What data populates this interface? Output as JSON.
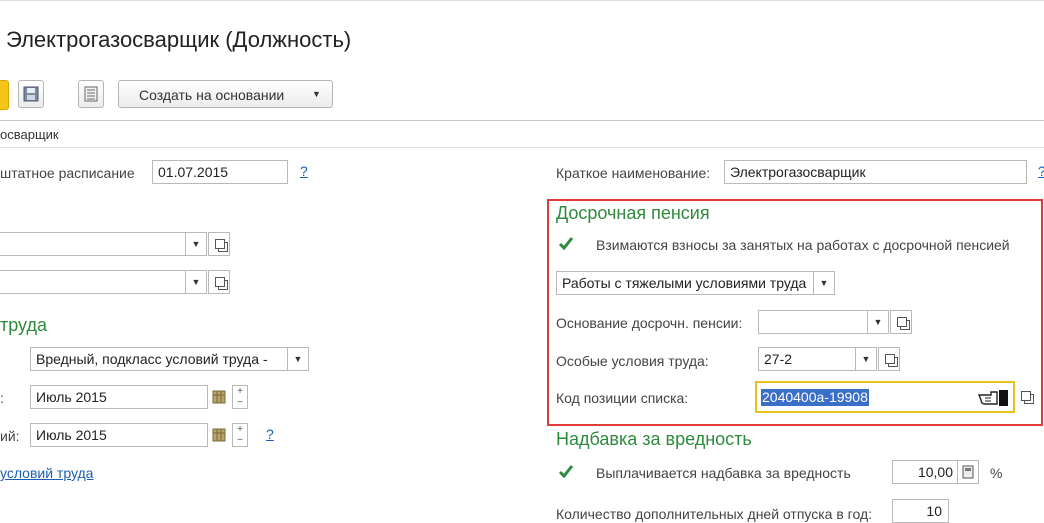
{
  "window": {
    "title": "Электрогазосварщик (Должность)"
  },
  "toolbar": {
    "create_based_on_label": "Создать на основании",
    "dropdown_arrow": "▼"
  },
  "breadcrumb": {
    "text": "осварщик"
  },
  "left": {
    "staff_schedule_label": "штатное расписание",
    "staff_schedule_date": "01.07.2015",
    "help_mark": "?",
    "field1_value": "",
    "field2_value": "",
    "section_title": "труда",
    "conditions_value": "Вредный, подкласс условий труда -",
    "date1_value": "Июль 2015",
    "date1_label_tail": ":",
    "date2_value": "Июль 2015",
    "date2_label_tail": "ий:",
    "link_text": "условий труда"
  },
  "right": {
    "short_name_label": "Краткое наименование:",
    "short_name_value": "Электрогазосварщик",
    "help_mark": "?",
    "early_pension": {
      "title": "Досрочная пенсия",
      "checkbox_label": "Взимаются взносы за занятых на работах с досрочной пенсией",
      "checkbox_checked": true,
      "work_type_value": "Работы с тяжелыми условиями труда",
      "basis_label": "Основание досрочн. пенсии:",
      "basis_value": "",
      "special_conditions_label": "Особые условия труда:",
      "special_conditions_value": "27-2",
      "list_code_label": "Код позиции списка:",
      "list_code_value": "2040400а-19908"
    },
    "hazard": {
      "title": "Надбавка за вредность",
      "checkbox_label": "Выплачивается надбавка за вредность",
      "checkbox_checked": true,
      "amount_value": "10,00",
      "percent_sign": "%",
      "extra_days_label": "Количество дополнительных дней отпуска в год:",
      "extra_days_value": "10"
    }
  },
  "colors": {
    "accent_green": "#2e8b3e",
    "highlight_border": "#e03c3c",
    "active_field_border": "#e8c21a",
    "selection": "#3a6fc8"
  }
}
